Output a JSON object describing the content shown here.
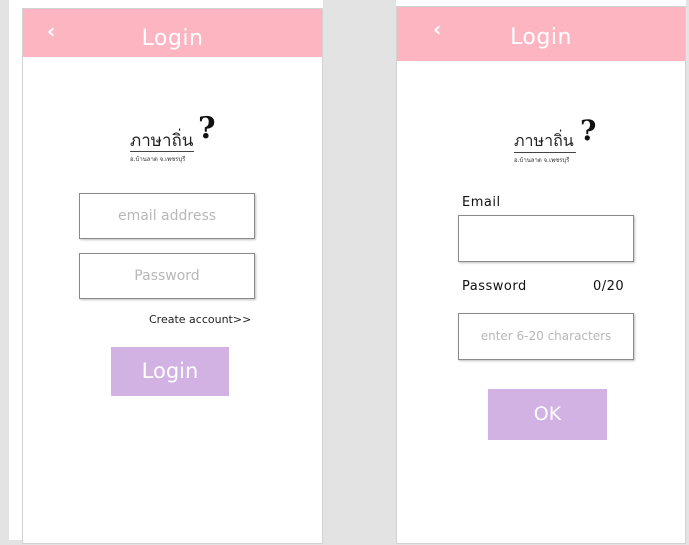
{
  "login_screen": {
    "back_icon": "chevron-left",
    "title": "Login",
    "logo": {
      "main": "ภาษาถิ่น",
      "subtitle": "อ.บ้านลาด จ.เพชรบุรี",
      "mark": "?"
    },
    "email_placeholder": "email address",
    "password_placeholder": "Password",
    "create_account_link": "Create account>>",
    "login_button": "Login"
  },
  "signup_screen": {
    "back_icon": "chevron-left",
    "title": "Login",
    "logo": {
      "main": "ภาษาถิ่น",
      "subtitle": "อ.บ้านลาด จ.เพชรบุรี",
      "mark": "?"
    },
    "email_label": "Email",
    "email_value": "",
    "password_label": "Password",
    "password_counter": "0/20",
    "password_placeholder": "enter 6-20 characters",
    "ok_button": "OK"
  },
  "colors": {
    "topbar": "#fdb6c1",
    "button": "#d2b1e3",
    "background_gutter": "#e3e3e3"
  }
}
